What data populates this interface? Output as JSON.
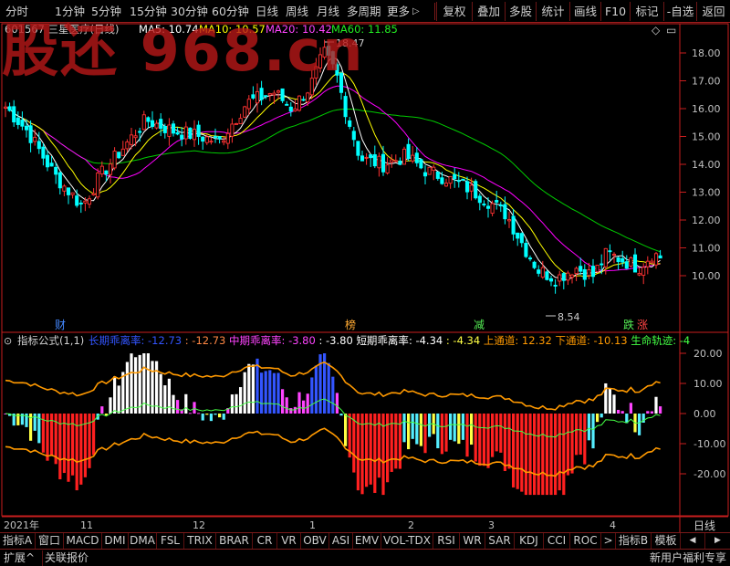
{
  "toolbar": {
    "periods": [
      "分时",
      "1分钟",
      "5分钟",
      "15分钟",
      "30分钟",
      "60分钟",
      "日线",
      "周线",
      "月线",
      "多周期",
      "更多"
    ],
    "more_arrow": "▷",
    "right": [
      "复权",
      "叠加",
      "多股",
      "统计",
      "画线",
      "F10",
      "标记",
      "-自选",
      "返回"
    ]
  },
  "watermark": "股还 968.cn",
  "chart": {
    "code": "601567",
    "name": "三星医疗(日线)",
    "ma_labels": [
      "MA5: 10.74",
      "MA10: 10.57",
      "MA20: 10.42",
      "MA60: 11.85"
    ],
    "high_label": "18.47",
    "low_label": "8.54",
    "y_ticks": [
      "18.00",
      "17.00",
      "16.00",
      "15.00",
      "14.00",
      "13.00",
      "12.00",
      "11.00",
      "10.00"
    ],
    "events": [
      "财",
      "榜",
      "减",
      "跌",
      "涨"
    ],
    "icons": [
      "◇",
      "▭"
    ],
    "colors": {
      "up": "#ff3232",
      "down": "#00ffff",
      "ma5": "#ffffff",
      "ma10": "#ffff00",
      "ma20": "#ff00ff",
      "ma60": "#00cc00",
      "axis": "#c81e1e",
      "orange": "#ff9900"
    }
  },
  "indicator": {
    "toggle": "⊙",
    "name": "指标公式(1,1)",
    "items": [
      {
        "label": "长期乖离率",
        "value": "-12.73",
        "color": "#3355ff"
      },
      {
        "label": "",
        "value": "-12.73",
        "color": "#ff8844"
      },
      {
        "label": "中期乖离率",
        "value": "-3.80",
        "color": "#ff44ff"
      },
      {
        "label": "",
        "value": "-3.80",
        "color": "#ffffff"
      },
      {
        "label": "短期乖离率",
        "value": "-4.34",
        "color": "#ffffff"
      },
      {
        "label": "",
        "value": "-4.34",
        "color": "#ffff44"
      },
      {
        "label": "上通道",
        "value": "12.32",
        "color": "#ff9900"
      },
      {
        "label": "下通道",
        "value": "-10.13",
        "color": "#ff9900"
      },
      {
        "label": "生命轨迹",
        "value": "-4",
        "color": "#44ff44"
      }
    ],
    "y_ticks": [
      "20.00",
      "10.00",
      "0.00",
      "-10.00",
      "-20.00"
    ]
  },
  "time_axis": {
    "labels": [
      "2021年",
      "11",
      "12",
      "1",
      "2",
      "3",
      "4"
    ],
    "period": "日线"
  },
  "tabs": [
    "指标A",
    "窗口",
    "MACD",
    "DMI",
    "DMA",
    "FSL",
    "TRIX",
    "BRAR",
    "CR",
    "VR",
    "OBV",
    "ASI",
    "EMV",
    "VOL-TDX",
    "RSI",
    "WR",
    "SAR",
    "KDJ",
    "CCI",
    "ROC",
    ">",
    "指标B",
    "模板"
  ],
  "tab_arrows": [
    "◀",
    "▶"
  ],
  "status": {
    "expand": "扩展^",
    "quote": "关联报价",
    "promo": "新用户福利专享"
  }
}
